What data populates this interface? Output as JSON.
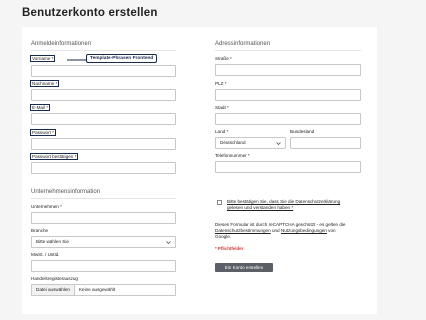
{
  "page": {
    "title": "Benutzerkonto erstellen"
  },
  "login": {
    "section_title": "Anmeldeinformationen",
    "firstname_label": "Vorname *",
    "tooltip": "Template-Phrasen Frontend",
    "lastname_label": "Nachname *",
    "email_label": "E-Mail *",
    "password_label": "Passwort *",
    "password_confirm_label": "Passwort bestätigen *"
  },
  "company": {
    "section_title": "Unternehmensinformation",
    "company_label": "Unternehmen *",
    "industry_label": "Branche",
    "industry_value": "Bitte wählen Sie",
    "vat_label": "MwSt. / UstId.",
    "registry_label": "Handelsregisterauszug",
    "file_button": "Datei auswählen",
    "file_status": "Keine ausgewählt"
  },
  "address": {
    "section_title": "Adressinformationen",
    "street_label": "Straße *",
    "zip_label": "PLZ *",
    "city_label": "Stadt *",
    "country_label": "Land *",
    "country_value": "Deutschland",
    "state_label": "Bundesland",
    "phone_label": "Telefonnummer *"
  },
  "consent": {
    "privacy_text_line1": "Bitte bestätigen Sie, dass Sie die Datenschutzerklärung",
    "privacy_text_line2": "gelesen und verstanden haben *",
    "recaptcha_line1": "Dieses Formular ist durch reCAPTCHA geschützt - es gelten die",
    "recaptcha_link1": "Datenschutzbestimmungen",
    "recaptcha_and": " und ",
    "recaptcha_link2": "Nutzungsbedingungen",
    "recaptcha_suffix": " von",
    "recaptcha_line3": "Google.",
    "required_note": "* Pflichtfelder",
    "submit_label": "Ein Konto erstellen"
  },
  "colors": {
    "accent_dark": "#1a2a4a",
    "required_red": "#d23b3b",
    "submit_bg": "#5b5f66"
  }
}
